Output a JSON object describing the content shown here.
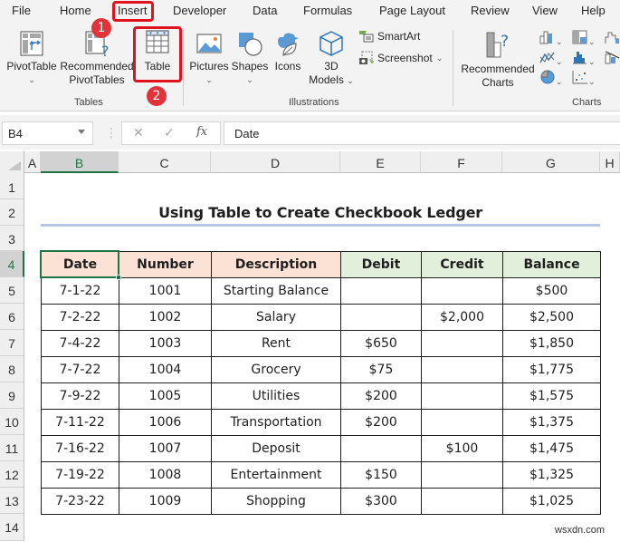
{
  "menu": {
    "tabs": [
      {
        "label": "File"
      },
      {
        "label": "Home"
      },
      {
        "label": "Insert"
      },
      {
        "label": "Developer"
      },
      {
        "label": "Data"
      },
      {
        "label": "Formulas"
      },
      {
        "label": "Page Layout"
      },
      {
        "label": "Review"
      },
      {
        "label": "View"
      },
      {
        "label": "Help"
      }
    ],
    "active_tab": "Insert"
  },
  "ribbon": {
    "groups": {
      "tables": {
        "label": "Tables",
        "pivottable": "PivotTable",
        "recommended_pivottables_line1": "Recommended",
        "recommended_pivottables_line2": "PivotTables",
        "table": "Table"
      },
      "illustrations": {
        "label": "Illustrations",
        "pictures": "Pictures",
        "shapes": "Shapes",
        "icons": "Icons",
        "models_line1": "3D",
        "models_line2": "Models",
        "smartart": "SmartArt",
        "screenshot": "Screenshot"
      },
      "charts": {
        "label": "Charts",
        "recommended_charts_line1": "Recommended",
        "recommended_charts_line2": "Charts"
      }
    }
  },
  "formula_bar": {
    "name_box": "B4",
    "cancel_icon": "✕",
    "enter_icon": "✓",
    "fx_label": "fx",
    "formula": "Date"
  },
  "grid": {
    "columns": [
      "A",
      "B",
      "C",
      "D",
      "E",
      "F",
      "G",
      "H"
    ],
    "selected_column": "B",
    "rows": [
      "1",
      "2",
      "3",
      "4",
      "5",
      "6",
      "7",
      "8",
      "9",
      "10",
      "11",
      "12",
      "13",
      "14"
    ],
    "selected_row": "4"
  },
  "sheet": {
    "title": "Using Table to Create Checkbook Ledger",
    "headers": [
      "Date",
      "Number",
      "Description",
      "Debit",
      "Credit",
      "Balance"
    ],
    "rows": [
      [
        "7-1-22",
        "1001",
        "Starting Balance",
        "",
        "",
        "$500"
      ],
      [
        "7-2-22",
        "1002",
        "Salary",
        "",
        "$2,000",
        "$2,500"
      ],
      [
        "7-4-22",
        "1003",
        "Rent",
        "$650",
        "",
        "$1,850"
      ],
      [
        "7-7-22",
        "1004",
        "Grocery",
        "$75",
        "",
        "$1,775"
      ],
      [
        "7-9-22",
        "1005",
        "Utilities",
        "$200",
        "",
        "$1,575"
      ],
      [
        "7-11-22",
        "1006",
        "Transportation",
        "$200",
        "",
        "$1,375"
      ],
      [
        "7-16-22",
        "1007",
        "Deposit",
        "",
        "$100",
        "$1,475"
      ],
      [
        "7-19-22",
        "1008",
        "Entertainment",
        "$150",
        "",
        "$1,325"
      ],
      [
        "7-23-22",
        "1009",
        "Shopping",
        "$300",
        "",
        "$1,025"
      ]
    ]
  },
  "annotations": {
    "step1": "1",
    "step2": "2",
    "highlight_color": "#e0141e"
  },
  "colors": {
    "accent_green": "#217346",
    "header_pink": "#fbe2d5",
    "header_green": "#e2efda",
    "title_underline": "#b4c7e7"
  },
  "watermark": "wsxdn.com"
}
